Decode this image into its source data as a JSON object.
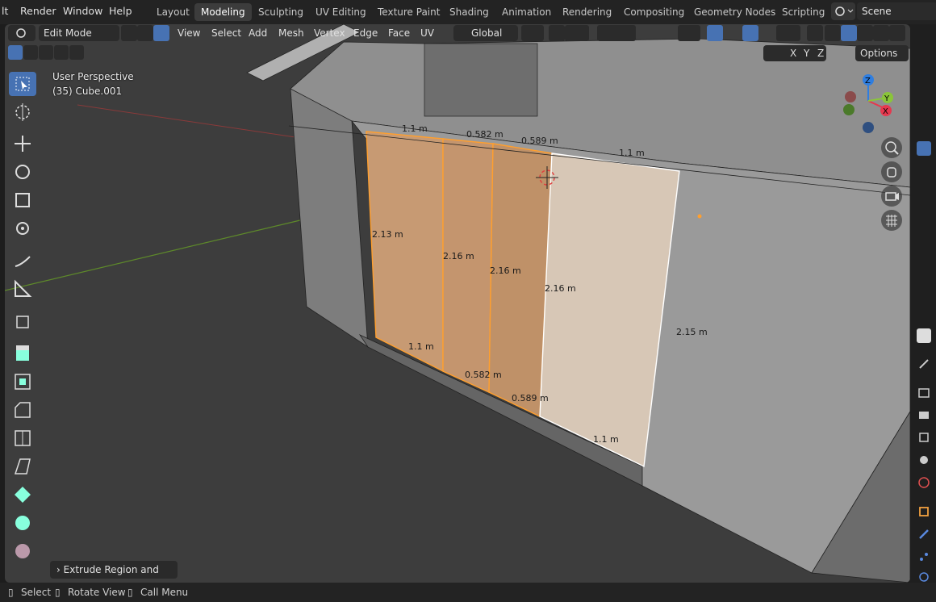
{
  "menubar": {
    "items": [
      "lt",
      "Render",
      "Window",
      "Help"
    ],
    "workspaces": [
      "Layout",
      "Modeling",
      "Sculpting",
      "UV Editing",
      "Texture Paint",
      "Shading",
      "Animation",
      "Rendering",
      "Compositing",
      "Geometry Nodes",
      "Scripting"
    ],
    "active_workspace": "Modeling",
    "scene": "Scene"
  },
  "header": {
    "mode": "Edit Mode",
    "menus": [
      "View",
      "Select",
      "Add",
      "Mesh",
      "Vertex",
      "Edge",
      "Face",
      "UV"
    ],
    "orientation": "Global",
    "options": "Options",
    "axes": [
      "X",
      "Y",
      "Z"
    ]
  },
  "viewport": {
    "perspective": "User Perspective",
    "object": "(35) Cube.001",
    "measurements": [
      "1.1 m",
      "0.582 m",
      "0.589 m",
      "1.1 m",
      "2.13 m",
      "2.16 m",
      "2.16 m",
      "2.16 m",
      "2.15 m",
      "1.1 m",
      "0.582 m",
      "0.589 m",
      "1.1 m"
    ],
    "gizmo_axes": [
      "Z",
      "Y",
      "X"
    ]
  },
  "last_operator": "Extrude Region and Move",
  "statusbar": {
    "items": [
      "Select",
      "Rotate View",
      "Call Menu"
    ]
  },
  "colors": {
    "selection": "#ff9f2e",
    "active_blue": "#4772b3",
    "axis_x": "#e6384e",
    "axis_y": "#8ac53a",
    "axis_z": "#2f7ee0"
  }
}
